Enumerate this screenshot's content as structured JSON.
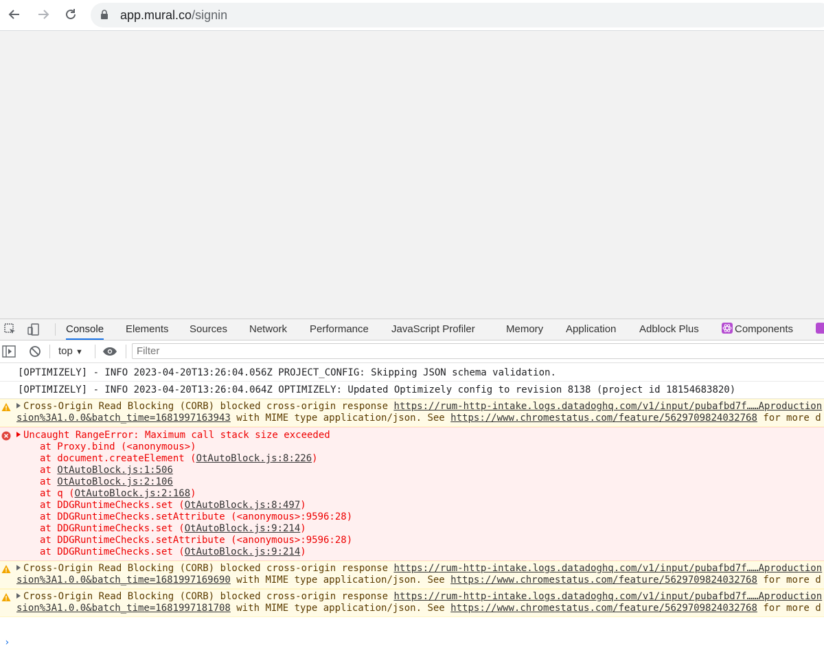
{
  "browser": {
    "url_domain": "app.mural.co",
    "url_path": "/signin"
  },
  "devtools": {
    "tabs": [
      "Console",
      "Elements",
      "Sources",
      "Network",
      "Performance",
      "JavaScript Profiler",
      "Memory",
      "Application",
      "Adblock Plus",
      "Components"
    ],
    "active_tab": "Console",
    "toolbar": {
      "context": "top",
      "filter_placeholder": "Filter"
    },
    "messages": {
      "info1": "[OPTIMIZELY] - INFO  2023-04-20T13:26:04.056Z PROJECT_CONFIG: Skipping JSON schema validation.",
      "info2": "[OPTIMIZELY] - INFO  2023-04-20T13:26:04.064Z OPTIMIZELY: Updated Optimizely config to revision 8138 (project id 18154683820)",
      "corb_prefix": "Cross-Origin Read Blocking (CORB) blocked cross-origin response ",
      "corb_url": "https://rum-http-intake.logs.datadoghq.com/v1/input/pubafbd7f……Aproduction",
      "corb_mid": " with MIME type application/json. See ",
      "corb_link": "https://www.chromestatus.com/feature/5629709824032768",
      "corb_suffix": " for more d",
      "warn1_batch": "sion%3A1.0.0&batch_time=1681997163943",
      "warn2_batch": "sion%3A1.0.0&batch_time=1681997169690",
      "warn3_batch": "sion%3A1.0.0&batch_time=1681997181708",
      "error_title": "Uncaught RangeError: Maximum call stack size exceeded",
      "stack": {
        "l1": "at Proxy.bind (<anonymous>)",
        "l2_a": "at document.createElement (",
        "l2_link": "OtAutoBlock.js:8:226",
        "l3_a": "at ",
        "l3_link": "OtAutoBlock.js:1:506",
        "l4_link": "OtAutoBlock.js:2:106",
        "l5_a": "at q (",
        "l5_link": "OtAutoBlock.js:2:168",
        "l6_a": "at DDGRuntimeChecks.set (",
        "l6_link": "OtAutoBlock.js:8:497",
        "l7": "at DDGRuntimeChecks.setAttribute (<anonymous>:9596:28)",
        "l8_link": "OtAutoBlock.js:9:214",
        "close": ")"
      }
    },
    "prompt": "›"
  }
}
